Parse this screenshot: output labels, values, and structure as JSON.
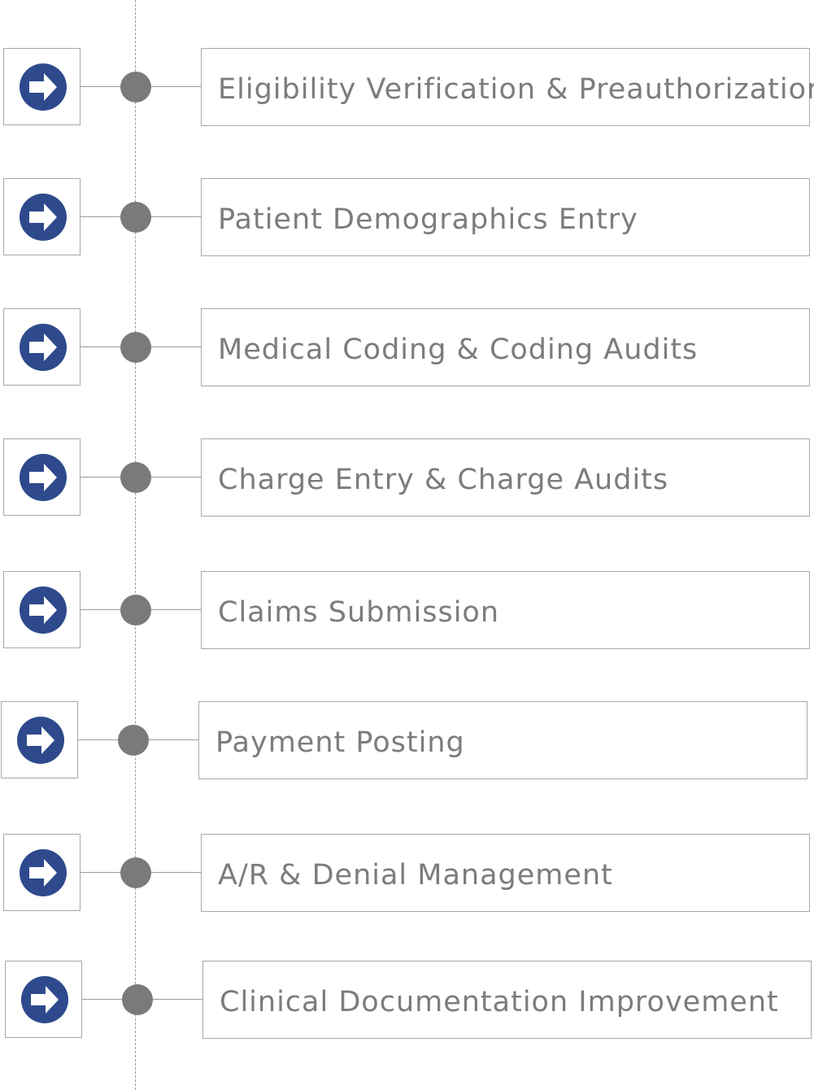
{
  "colors": {
    "icon_circle": "#2e4a8c",
    "node": "#7a7a7a",
    "border": "#a8a8a8",
    "text": "#7c7c7c"
  },
  "steps": [
    {
      "label": "Eligibility Verification & Preauthorization",
      "icon": "arrow-right-circle-icon"
    },
    {
      "label": "Patient Demographics Entry",
      "icon": "arrow-right-circle-icon"
    },
    {
      "label": "Medical Coding & Coding Audits",
      "icon": "arrow-right-circle-icon"
    },
    {
      "label": "Charge Entry & Charge Audits",
      "icon": "arrow-right-circle-icon"
    },
    {
      "label": "Claims Submission",
      "icon": "arrow-right-circle-icon"
    },
    {
      "label": "Payment Posting",
      "icon": "arrow-right-circle-icon"
    },
    {
      "label": "A/R & Denial Management",
      "icon": "arrow-right-circle-icon"
    },
    {
      "label": "Clinical Documentation Improvement",
      "icon": "arrow-right-circle-icon"
    }
  ]
}
